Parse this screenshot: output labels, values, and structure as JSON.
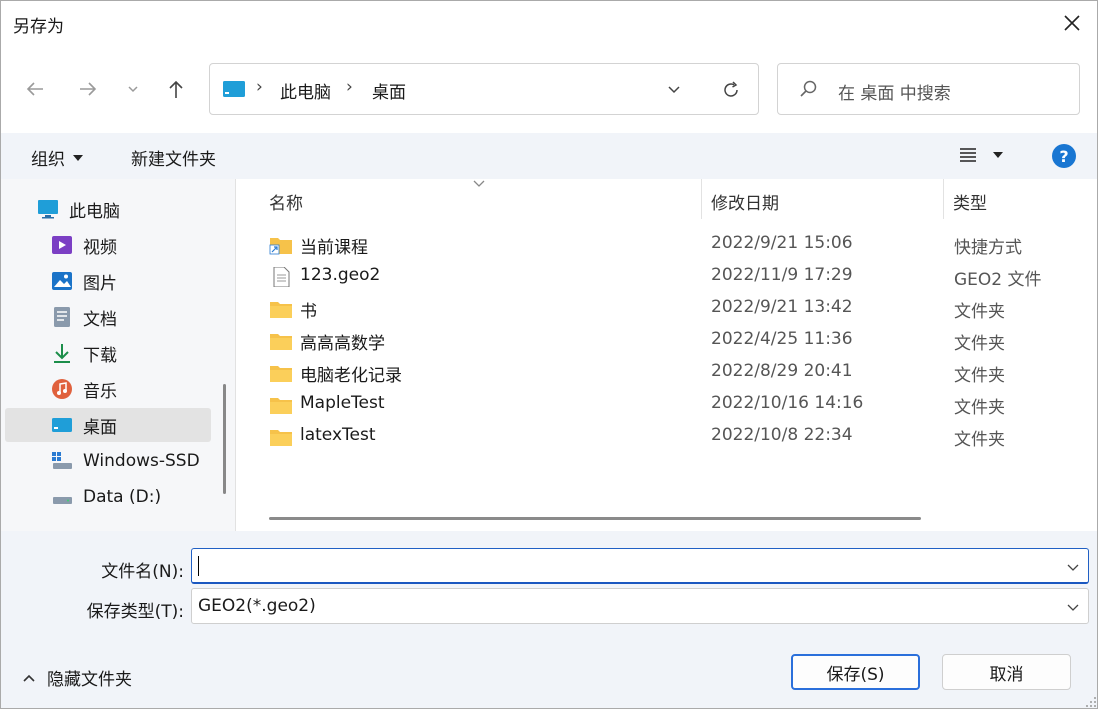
{
  "window": {
    "title": "另存为"
  },
  "address": {
    "crumbs": [
      "此电脑",
      "桌面"
    ]
  },
  "search": {
    "placeholder": "在 桌面 中搜索"
  },
  "toolbar": {
    "organize_label": "组织",
    "new_folder_label": "新建文件夹"
  },
  "sidebar": {
    "items": [
      {
        "label": "此电脑",
        "icon": "pc-icon"
      },
      {
        "label": "视频",
        "icon": "video-icon"
      },
      {
        "label": "图片",
        "icon": "picture-icon"
      },
      {
        "label": "文档",
        "icon": "document-icon"
      },
      {
        "label": "下载",
        "icon": "download-icon"
      },
      {
        "label": "音乐",
        "icon": "music-icon"
      },
      {
        "label": "桌面",
        "icon": "desktop-icon",
        "selected": true
      },
      {
        "label": "Windows-SSD",
        "icon": "drive-icon"
      },
      {
        "label": "Data (D:)",
        "icon": "drive-icon"
      }
    ]
  },
  "list": {
    "columns": [
      "名称",
      "修改日期",
      "类型"
    ],
    "rows": [
      {
        "name": "当前课程",
        "date": "2022/9/21 15:06",
        "type": "快捷方式",
        "icon": "shortcut-folder-icon"
      },
      {
        "name": "123.geo2",
        "date": "2022/11/9 17:29",
        "type": "GEO2 文件",
        "icon": "file-icon"
      },
      {
        "name": "书",
        "date": "2022/9/21 13:42",
        "type": "文件夹",
        "icon": "folder-icon"
      },
      {
        "name": "高高高数学",
        "date": "2022/4/25 11:36",
        "type": "文件夹",
        "icon": "folder-icon"
      },
      {
        "name": "电脑老化记录",
        "date": "2022/8/29 20:41",
        "type": "文件夹",
        "icon": "folder-icon"
      },
      {
        "name": "MapleTest",
        "date": "2022/10/16 14:16",
        "type": "文件夹",
        "icon": "folder-icon"
      },
      {
        "name": "latexTest",
        "date": "2022/10/8 22:34",
        "type": "文件夹",
        "icon": "folder-icon"
      }
    ]
  },
  "form": {
    "filename_label": "文件名(N):",
    "filename_value": "",
    "filetype_label": "保存类型(T):",
    "filetype_value": "GEO2(*.geo2)"
  },
  "footer": {
    "hide_folders_label": "隐藏文件夹",
    "save_label": "保存(S)",
    "cancel_label": "取消"
  },
  "colors": {
    "accent": "#2a6fdb",
    "folder": "#f6c24a",
    "toolbar_bg": "#f1f4f9"
  }
}
